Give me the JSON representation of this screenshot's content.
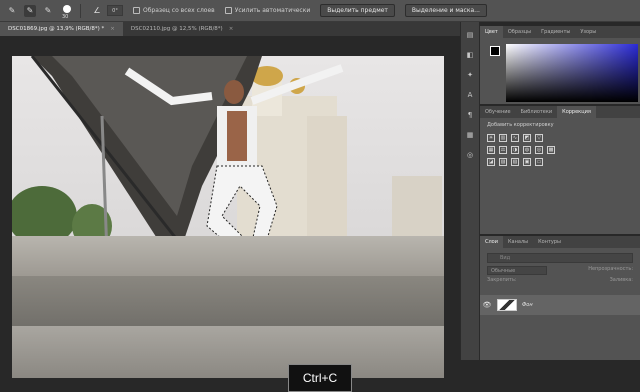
{
  "options_bar": {
    "brush_size": "30",
    "angle": "0°",
    "sample_all_layers_label": "Образец со всех слоев",
    "auto_enhance_label": "Усилить автоматически",
    "select_subject_label": "Выделить предмет",
    "select_and_mask_label": "Выделение и маска..."
  },
  "document_tabs": [
    {
      "label": "DSC01869.jpg @ 13,9% (RGB/8*) *",
      "active": true
    },
    {
      "label": "DSC02110.jpg @ 12,5% (RGB/8*)",
      "active": false
    }
  ],
  "color_panel": {
    "tabs": [
      "Цвет",
      "Образцы",
      "Градиенты",
      "Узоры"
    ],
    "active_tab": "Цвет",
    "foreground_color": "#000000",
    "background_color": "#ffffff"
  },
  "adjustments_panel": {
    "tabs": [
      "Обучение",
      "Библиотеки",
      "Коррекция"
    ],
    "active_tab": "Коррекция",
    "title": "Добавить корректировку"
  },
  "layers_panel": {
    "tabs": [
      "Слои",
      "Каналы",
      "Контуры"
    ],
    "active_tab": "Слои",
    "search_placeholder": "Вид",
    "blend_mode": "Обычные",
    "opacity_label": "Непрозрачность:",
    "lock_label": "Закрепить:",
    "fill_label": "Заливка:",
    "layer_name": "Фон"
  },
  "shortcut_overlay": "Ctrl+C"
}
